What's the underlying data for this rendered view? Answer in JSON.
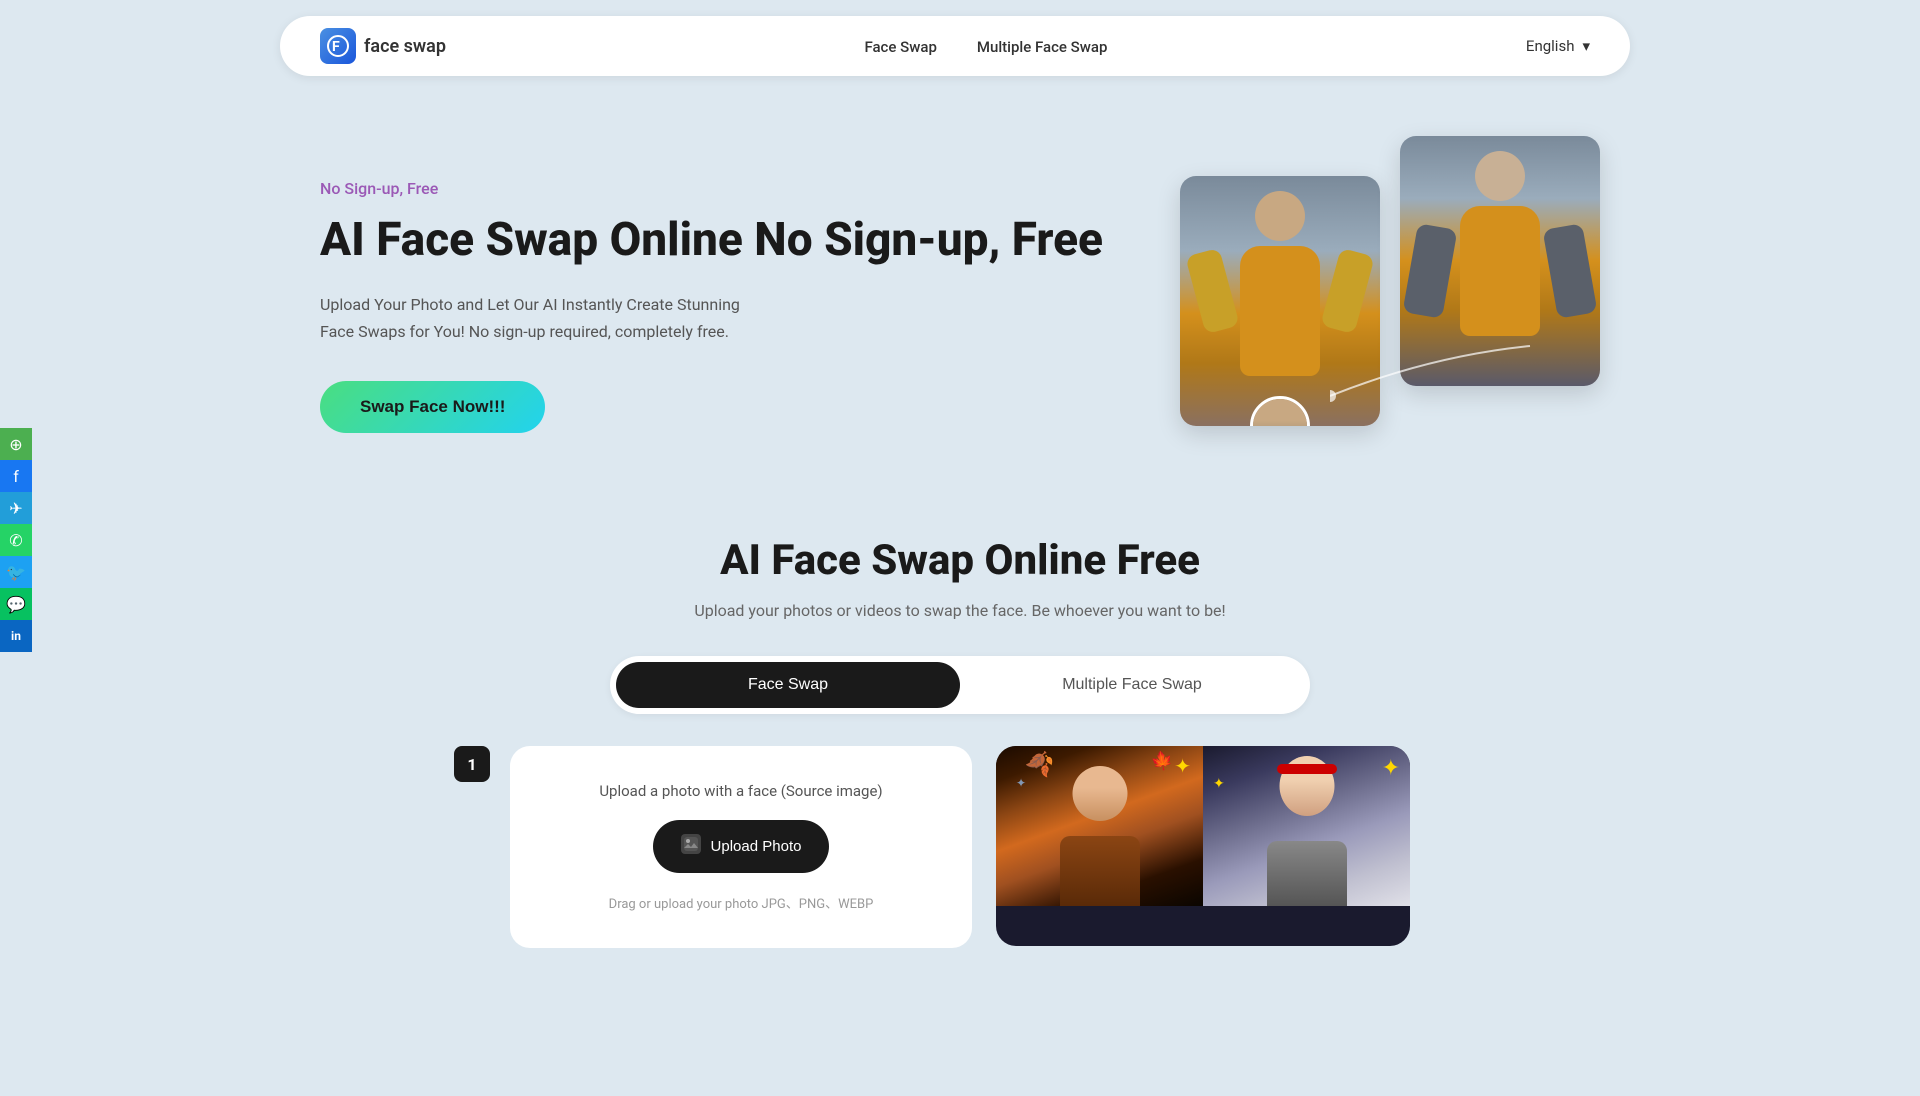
{
  "brand": {
    "name": "face swap",
    "logo_icon": "F"
  },
  "nav": {
    "links": [
      {
        "label": "Face Swap",
        "href": "#"
      },
      {
        "label": "Multiple Face Swap",
        "href": "#"
      }
    ],
    "language": "English",
    "language_icon": "▾"
  },
  "hero": {
    "tag": "No Sign-up, Free",
    "title": "AI Face Swap Online No Sign-up, Free",
    "description": "Upload Your Photo and Let Our AI Instantly Create Stunning Face Swaps for You! No sign-up required, completely free.",
    "cta_label": "Swap Face Now!!!"
  },
  "section": {
    "title": "AI Face Swap Online Free",
    "description": "Upload your photos or videos to swap the face. Be whoever you want to be!"
  },
  "tabs": [
    {
      "label": "Face Swap",
      "active": true
    },
    {
      "label": "Multiple Face Swap",
      "active": false
    }
  ],
  "upload_panel": {
    "label": "Upload a photo with a face (Source image)",
    "button_label": "Upload Photo",
    "hint": "Drag or upload your photo JPG、PNG、WEBP",
    "step_number": "1",
    "upload_icon": "⬆"
  },
  "social": [
    {
      "name": "share",
      "icon": "⊕",
      "color": "#4CAF50"
    },
    {
      "name": "facebook",
      "icon": "f",
      "color": "#1877F2"
    },
    {
      "name": "telegram",
      "icon": "✈",
      "color": "#229ED9"
    },
    {
      "name": "whatsapp",
      "icon": "✆",
      "color": "#25D366"
    },
    {
      "name": "twitter",
      "icon": "🐦",
      "color": "#1DA1F2"
    },
    {
      "name": "wechat",
      "icon": "💬",
      "color": "#07C160"
    },
    {
      "name": "linkedin",
      "icon": "in",
      "color": "#0A66C2"
    }
  ],
  "colors": {
    "accent_gradient_start": "#4ade80",
    "accent_gradient_end": "#22d3ee",
    "background": "#dde8f0",
    "navbar_bg": "#ffffff",
    "upload_button_bg": "#1a1a1a",
    "tab_active_bg": "#1a1a1a",
    "tag_color": "#9b59b6"
  }
}
